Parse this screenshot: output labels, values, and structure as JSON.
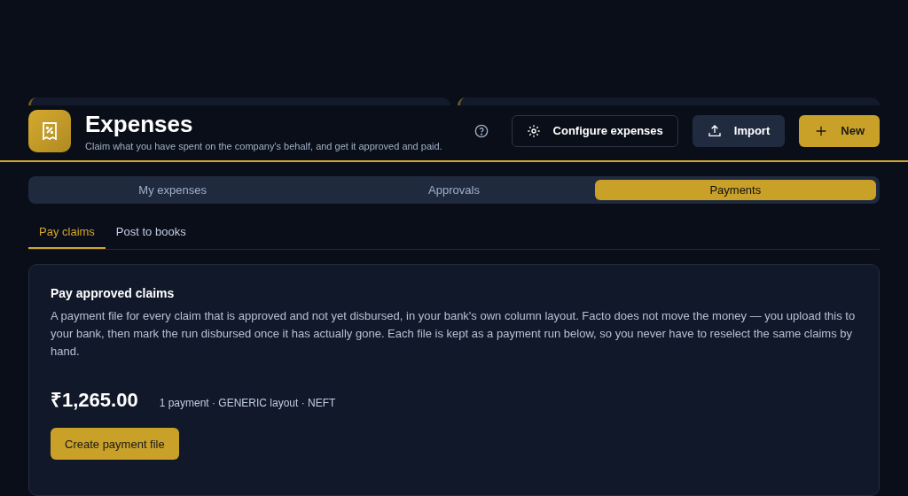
{
  "header": {
    "title": "Expenses",
    "subtitle": "Claim what you have spent on the company's behalf, and get it approved and paid.",
    "buttons": [
      {
        "kind": "outline",
        "label": "Configure expenses"
      },
      {
        "kind": "secondary",
        "label": "Import"
      },
      {
        "kind": "primary",
        "label": "New"
      }
    ]
  },
  "tabs": [
    {
      "label": "My expenses",
      "selected": false
    },
    {
      "label": "Approvals",
      "selected": false
    },
    {
      "label": "Payments",
      "selected": true
    }
  ],
  "subtabs": [
    {
      "label": "Pay claims",
      "selected": true
    },
    {
      "label": "Post to books",
      "selected": false
    }
  ],
  "card": {
    "title": "Pay approved claims",
    "description": "A payment file for every claim that is approved and not yet disbursed, in your bank's own column layout. Facto does not move the money — you upload this to your bank, then mark the run disbursed once it has actually gone. Each file is kept as a payment run below, so you never have to reselect the same claims by hand.",
    "amount": "₹1,265.00",
    "summary": "1 payment · GENERIC layout · NEFT",
    "button": "Create payment file"
  }
}
